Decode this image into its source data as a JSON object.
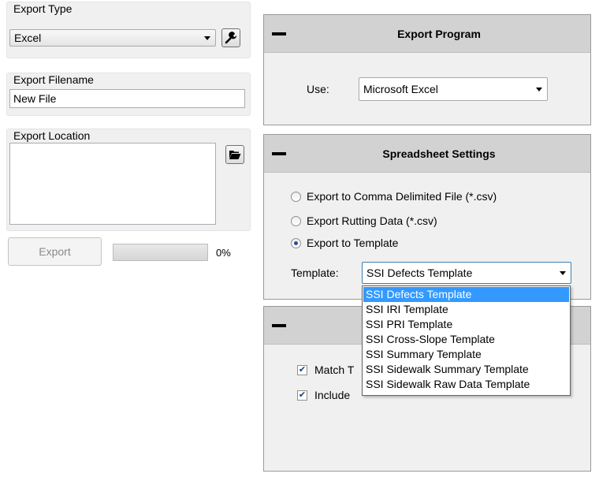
{
  "export_type": {
    "title": "Export Type",
    "selected": "Excel",
    "settings_icon": "wrench-icon"
  },
  "export_filename": {
    "title": "Export Filename",
    "value": "New File"
  },
  "export_location": {
    "title": "Export Location",
    "value": "",
    "browse_icon": "folder-open-icon"
  },
  "export_button": {
    "label": "Export"
  },
  "progress": {
    "value": 0,
    "label": "0%"
  },
  "export_program": {
    "title": "Export Program",
    "use_label": "Use:",
    "selected": "Microsoft Excel"
  },
  "spreadsheet_settings": {
    "title": "Spreadsheet Settings",
    "options": [
      {
        "label": "Export to Comma Delimited File (*.csv)",
        "checked": false
      },
      {
        "label": "Export Rutting Data (*.csv)",
        "checked": false
      },
      {
        "label": "Export to Template",
        "checked": true
      }
    ],
    "template_label": "Template:",
    "template_selected": "SSI Defects Template",
    "template_options": [
      "SSI Defects Template",
      "SSI IRI Template",
      "SSI PRI Template",
      "SSI Cross-Slope Template",
      "SSI Summary Template",
      "SSI Sidewalk Summary Template",
      "SSI Sidewalk Raw Data Template"
    ]
  },
  "third_panel": {
    "checkboxes": [
      {
        "label": "Match T",
        "checked": true
      },
      {
        "label": "Include",
        "checked": true
      }
    ]
  },
  "colors": {
    "panel_header": "#d2d2d2",
    "selection": "#3399ff",
    "window_bg": "#f0f0f0"
  }
}
